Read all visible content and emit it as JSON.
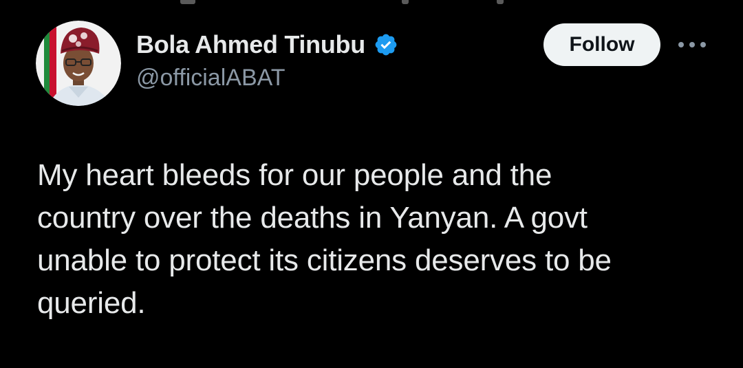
{
  "user": {
    "name": "Bola Ahmed Tinubu",
    "handle": "@officialABAT",
    "verified": true,
    "verified_icon": "verified-badge-icon",
    "verified_color": "#1d9bf0"
  },
  "actions": {
    "follow_label": "Follow",
    "more_icon": "more-horizontal-icon"
  },
  "tweet": {
    "text": "My heart bleeds for our people and the\ncountry over the deaths in Yanyan.  A govt\nunable to protect its citizens deserves to be\nqueried."
  },
  "colors": {
    "background": "#000000",
    "primary_text": "#e7e9ea",
    "secondary_text": "#8b98a5",
    "follow_bg": "#eff3f4",
    "follow_text": "#0f1419"
  }
}
